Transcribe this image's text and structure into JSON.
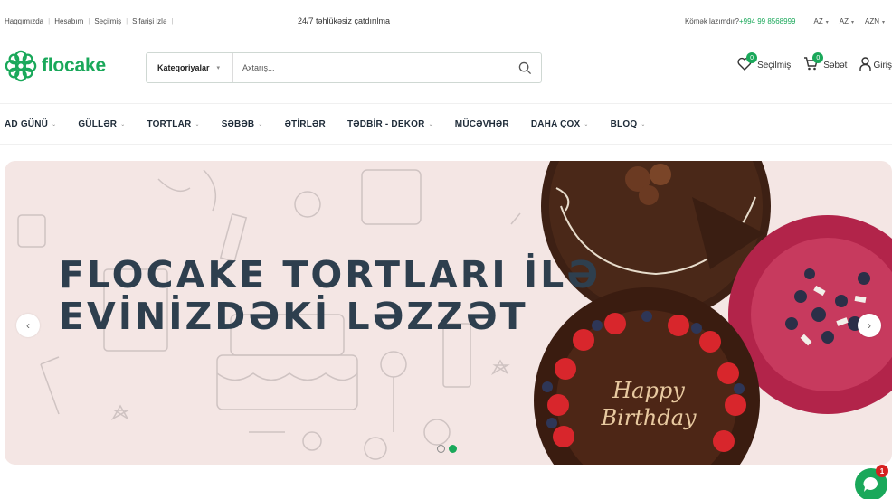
{
  "topbar": {
    "links": [
      "Haqqımızda",
      "Hesabım",
      "Seçilmiş",
      "Sifarişi izlə"
    ],
    "center_text": "24/7 təhlükəsiz çatdırılma",
    "help_text": "Kömək lazımdır?",
    "phone": "+994 99 8568999",
    "lang1": "AZ",
    "lang2": "AZ",
    "currency": "AZN"
  },
  "header": {
    "logo_text": "flocake",
    "category_label": "Kateqoriyalar",
    "search_placeholder": "Axtarış...",
    "wishlist": {
      "label": "Seçilmiş",
      "count": "0"
    },
    "cart": {
      "label": "Səbət",
      "count": "0"
    },
    "login_label": "Giriş"
  },
  "nav": [
    {
      "label": "AD GÜNÜ",
      "dropdown": true
    },
    {
      "label": "GÜLLƏR",
      "dropdown": true
    },
    {
      "label": "TORTLAR",
      "dropdown": true
    },
    {
      "label": "SƏBƏB",
      "dropdown": true
    },
    {
      "label": "ƏTİRLƏR",
      "dropdown": false
    },
    {
      "label": "TƏDBİR - DEKOR",
      "dropdown": true
    },
    {
      "label": "MÜCƏVHƏR",
      "dropdown": false
    },
    {
      "label": "DAHA ÇOX",
      "dropdown": true
    },
    {
      "label": "BLOQ",
      "dropdown": true
    }
  ],
  "hero": {
    "title_line1": "FLOCAKE TORTLARI İLƏ",
    "title_line2": "EVİNİZDƏKİ LƏZZƏT",
    "cake_text_1": "Happy",
    "cake_text_2": "Birthday",
    "slide_count": 2,
    "active_slide": 2
  },
  "chat": {
    "unread": "1"
  },
  "colors": {
    "brand": "#1aa85a",
    "hero_bg": "#f4e6e4",
    "title": "#2e3f4e"
  }
}
